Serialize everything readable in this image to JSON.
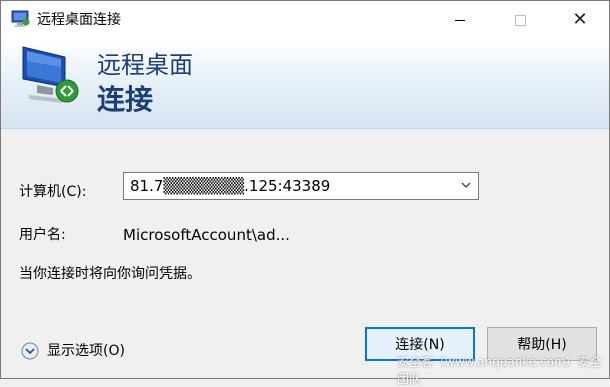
{
  "window": {
    "title": "远程桌面连接",
    "controls": {
      "minimize": "minimize",
      "maximize": "maximize",
      "close": "close"
    }
  },
  "banner": {
    "line1": "远程桌面",
    "line2": "连接",
    "icon": "remote-desktop-icon"
  },
  "form": {
    "computer_label": "计算机(C):",
    "computer_value": "81.7▒▒▒▒▒▒▒.125:43389",
    "user_label": "用户名:",
    "user_value": "MicrosoftAccount\\ad...",
    "info_text": "当你连接时将向你询问凭据。"
  },
  "footer": {
    "options_label": "显示选项(O)",
    "connect_label": "连接(N)",
    "help_label": "帮助(H)"
  },
  "watermark": "安全客（www.anquanke.com）安全团队",
  "colors": {
    "accent": "#0078d7",
    "title_blue": "#1c3f7a",
    "background": "#f0f0f0"
  }
}
